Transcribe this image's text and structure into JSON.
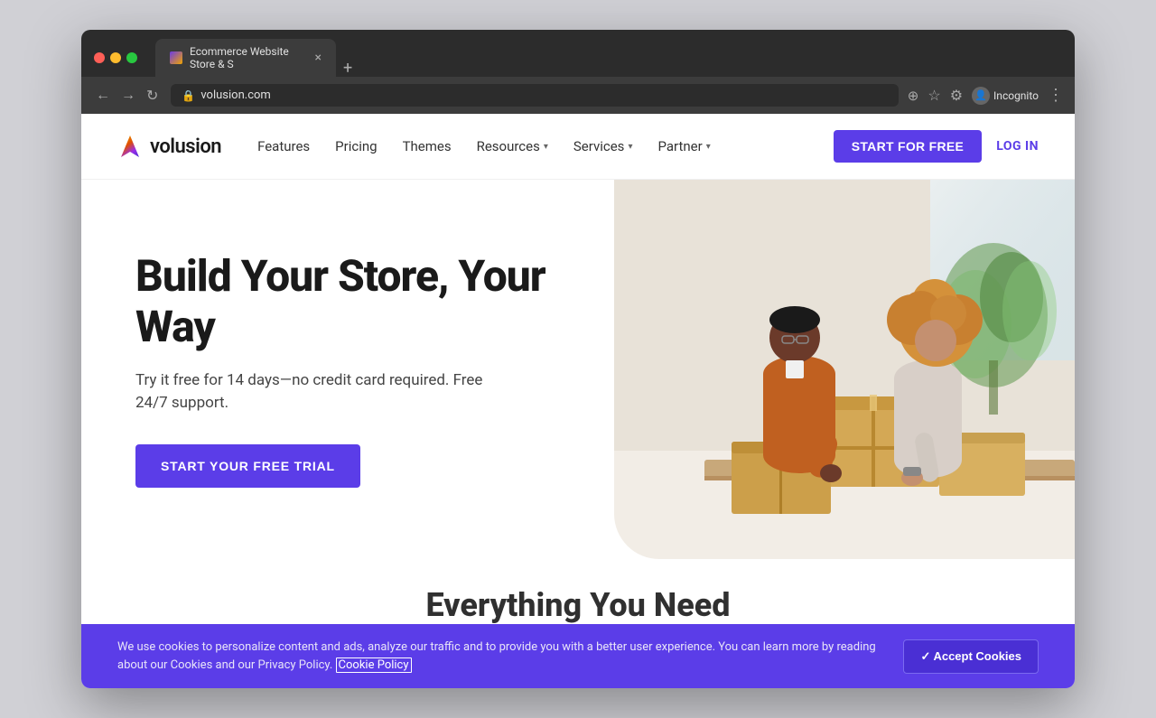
{
  "browser": {
    "tab_title": "Ecommerce Website Store & S",
    "url": "volusion.com",
    "incognito_label": "Incognito"
  },
  "nav": {
    "logo_text": "volusion",
    "links": [
      {
        "label": "Features",
        "has_dropdown": false
      },
      {
        "label": "Pricing",
        "has_dropdown": false
      },
      {
        "label": "Themes",
        "has_dropdown": false
      },
      {
        "label": "Resources",
        "has_dropdown": true
      },
      {
        "label": "Services",
        "has_dropdown": true
      },
      {
        "label": "Partner",
        "has_dropdown": true
      }
    ],
    "cta_button": "START FOR FREE",
    "login_button": "LOG IN"
  },
  "hero": {
    "title": "Build Your Store, Your Way",
    "subtitle": "Try it free for 14 days—no credit card required. Free 24/7 support.",
    "trial_button": "START YOUR FREE TRIAL"
  },
  "below": {
    "everything_title": "Everything You Need"
  },
  "cookie": {
    "text": "We use cookies to personalize content and ads, analyze our traffic and to provide you with a better user experience. You can learn more by reading about our Cookies and our Privacy Policy.",
    "link_text": "Cookie Policy",
    "accept_button": "✓ Accept Cookies"
  }
}
